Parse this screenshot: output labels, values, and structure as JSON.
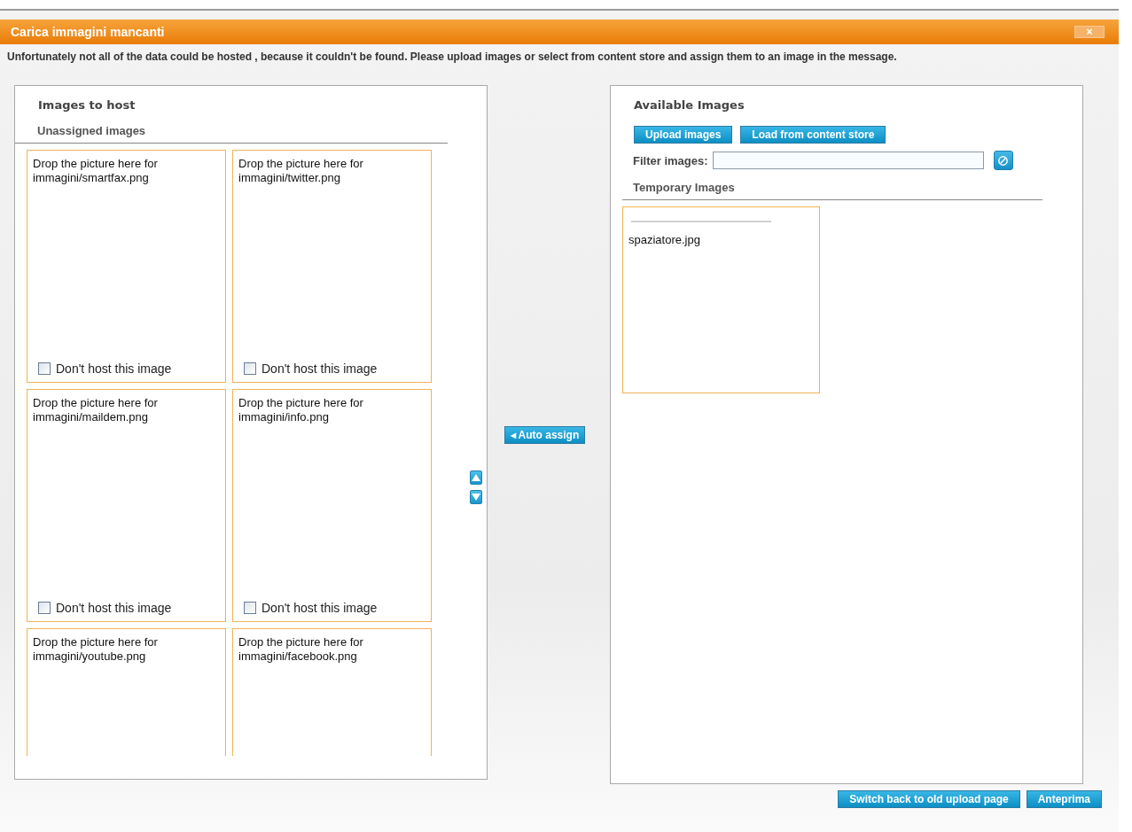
{
  "dialog": {
    "title": "Carica immagini mancanti",
    "close": "×"
  },
  "message": "Unfortunately not all of the data could be hosted , because it couldn't be found. Please upload images or select from content store and assign them to an image in the message.",
  "images_to_host": {
    "title": "Images to host",
    "section": "Unassigned images",
    "slots": [
      {
        "text": "Drop the picture here for immagini/smartfax.png",
        "checkbox_label": "Don't host this image",
        "checked": false
      },
      {
        "text": "Drop the picture here for immagini/twitter.png",
        "checkbox_label": "Don't host this image",
        "checked": false
      },
      {
        "text": "Drop the picture here for immagini/maildem.png",
        "checkbox_label": "Don't host this image",
        "checked": false
      },
      {
        "text": "Drop the picture here for immagini/info.png",
        "checkbox_label": "Don't host this image",
        "checked": false
      },
      {
        "text": "Drop the picture here for immagini/youtube.png"
      },
      {
        "text": "Drop the picture here for immagini/facebook.png"
      }
    ]
  },
  "auto_assign": "◂ Auto assign",
  "available_images": {
    "title": "Available Images",
    "buttons": [
      "Upload images",
      "Load from content store"
    ],
    "filter": {
      "label": "Filter images:"
    },
    "section": "Temporary Images",
    "items": [
      {
        "name": "spaziatore.jpg"
      }
    ]
  },
  "footer_buttons": [
    "Switch back to old upload page",
    "Anteprima"
  ]
}
